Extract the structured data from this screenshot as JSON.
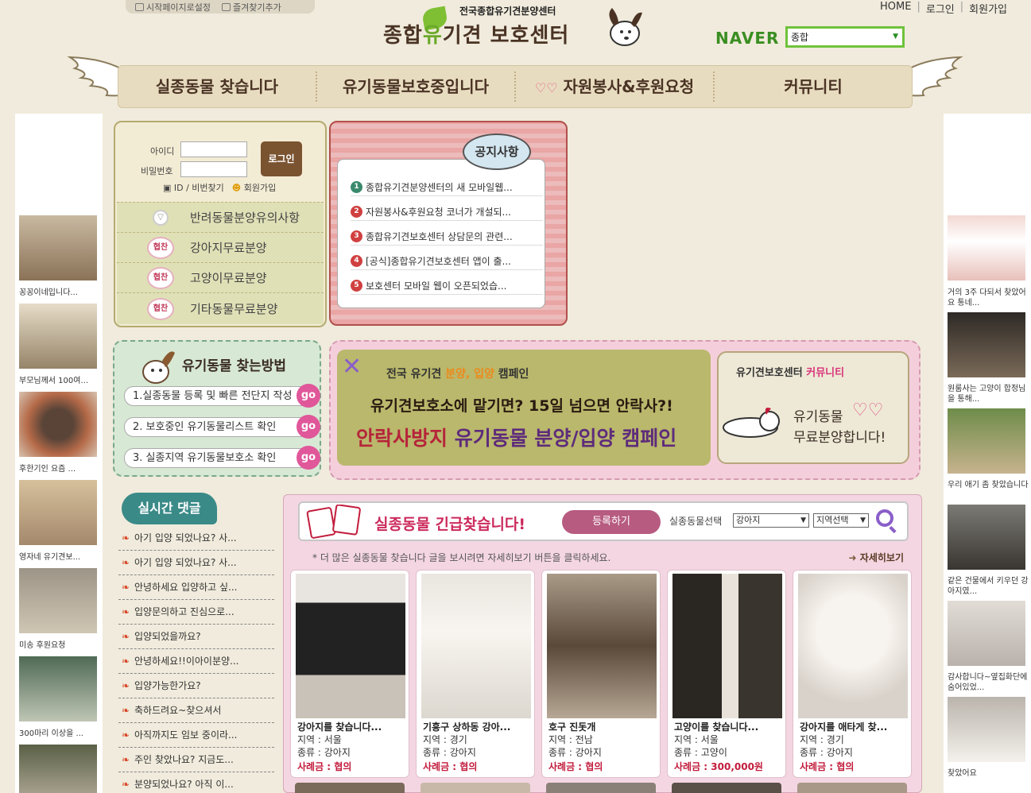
{
  "top_links": {
    "start": "시작페이지로설정",
    "bookmark": "즐겨찾기추가"
  },
  "top_nav": {
    "home": "HOME",
    "login": "로그인",
    "join": "회원가입"
  },
  "logo": {
    "subtitle": "전국종합유기견분양센터",
    "pre": "종합",
    "yu": "유",
    "rest": "기견 보호센터"
  },
  "search": {
    "brand": "NAVER",
    "selected": "종합"
  },
  "nav": [
    "실종동물 찾습니다",
    "유기동물보호중입니다",
    "자원봉사&후원요청",
    "커뮤니티"
  ],
  "login": {
    "id_label": "아이디",
    "pw_label": "비밀번호",
    "button": "로그인",
    "find": "ID / 비번찾기",
    "join": "회원가입"
  },
  "side_menu": [
    {
      "label": "반려동물분양유의사항",
      "badge": ""
    },
    {
      "label": "강아지무료분양",
      "badge": "협찬"
    },
    {
      "label": "고양이무료분양",
      "badge": "협찬"
    },
    {
      "label": "기타동물무료분양",
      "badge": "협찬"
    }
  ],
  "notice": {
    "title": "공지사항",
    "items": [
      "종합유기견분양센터의 새 모바일웹...",
      "자원봉사&후원요청 코너가 개설되...",
      "종합유기견보호센터 상담문의 관련...",
      "[공식]종합유기견보호센터 앱이 출...",
      "보호센터 모바일 웹이 오픈되었습..."
    ]
  },
  "howto": {
    "title": "유기동물 찾는방법",
    "steps": [
      "1.실종동물 등록 및 빠른 전단지 작성",
      "2. 보호중인 유기동물리스트 확인",
      "3. 실종지역 유기동물보호소 확인"
    ],
    "go": "go"
  },
  "campaign": {
    "line1a": "전국 유기견 ",
    "line1b": "분양, 입양",
    "line1c": " 캠페인",
    "line2": "유기견보호소에 맡기면? 15일 넘으면 안락사?!",
    "line3a": "안락사방지",
    "line3b": " 유기동물 분양/입양 캠페인",
    "right_a": "유기견보호센터 ",
    "right_b": "커뮤니티",
    "right_l1": "유기동물",
    "right_l2": "무료분양합니다!"
  },
  "comments": {
    "title": "실시간 댓글",
    "items": [
      "아기 입양 되었나요? 사...",
      "아기 입양 되었나요? 사...",
      "안녕하세요 입양하고 싶...",
      "입양문의하고 진심으로...",
      "입양되었을까요?",
      "안녕하세요!!이아이분양...",
      "입양가능한가요?",
      "축하드려요~찾으셔서",
      "아직까지도 임보 중이라...",
      "주인 찾았나요? 지금도...",
      "분양되었나요? 아직 이..."
    ]
  },
  "lost": {
    "title": "실종동물 긴급찾습니다!",
    "register": "등록하기",
    "select_label": "실종동물선택",
    "select_animal": "강아지",
    "select_region": "지역선택",
    "info": "* 더 많은 실종동물 찾습니다 글을 보시려면 자세히보기 버튼을 클릭하세요.",
    "more": "자세히보기",
    "cards": [
      {
        "title": "강아지를 찾습니다...",
        "region": "지역 : 서울",
        "kind": "종류 : 강아지",
        "reward": "사례금 : 협의"
      },
      {
        "title": "기흥구 상하동 강아...",
        "region": "지역 : 경기",
        "kind": "종류 : 강아지",
        "reward": "사례금 : 협의"
      },
      {
        "title": "호구 진돗개",
        "region": "지역 : 전남",
        "kind": "종류 : 강아지",
        "reward": "사례금 : 협의"
      },
      {
        "title": "고양이를 찾습니다...",
        "region": "지역 : 서울",
        "kind": "종류 : 고양이",
        "reward": "사례금 : 300,000원"
      },
      {
        "title": "강아지를 애타게 찾...",
        "region": "지역 : 경기",
        "kind": "종류 : 강아지",
        "reward": "사례금 : 협의"
      }
    ]
  },
  "left_captions": [
    "꽁꽁이네입니다...",
    "부모님께서 100여...",
    "후한기인 요즘 ...",
    "영자네 유기견보...",
    "미송 후원요청",
    "300마리 이상을 ..."
  ],
  "right_captions": [
    "거의 3주 다되서 찾았어요 통네...",
    "원룸사는 고양이 합정님을 통해...",
    "우리 애기 좀 찾았습니다",
    "같은 건물에서 키우던 강아지였...",
    "감사합니다~옆집화단에 숨어있었...",
    "찾았어요"
  ]
}
